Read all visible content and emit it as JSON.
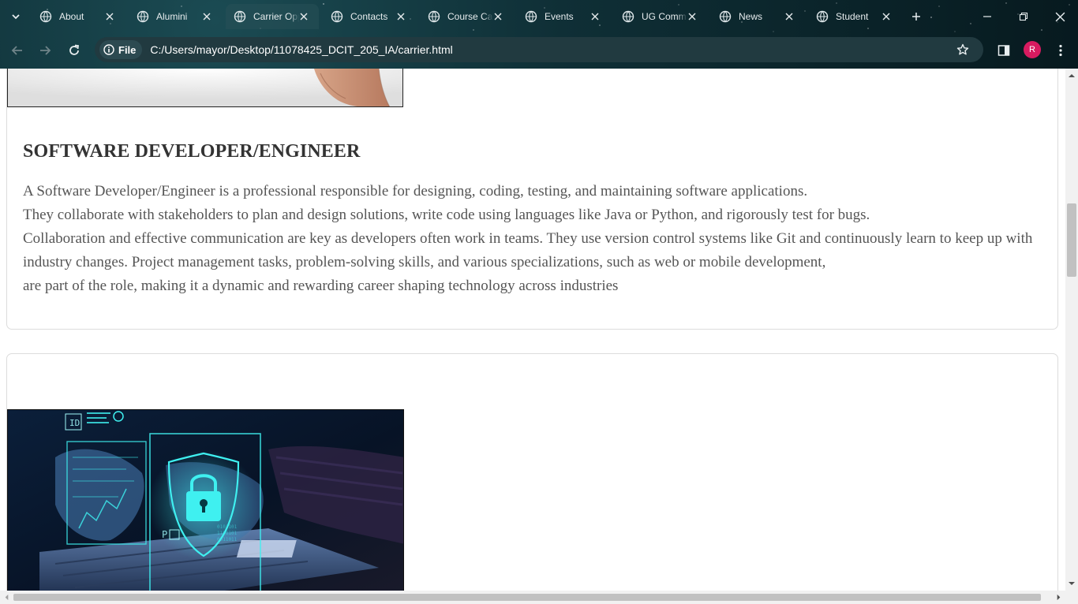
{
  "browser": {
    "tabs": [
      {
        "title": "About",
        "active": false
      },
      {
        "title": "Alumini",
        "active": false
      },
      {
        "title": "Carrier Opportunities",
        "active": true
      },
      {
        "title": "Contacts",
        "active": false
      },
      {
        "title": "Course Catalog",
        "active": false
      },
      {
        "title": "Events",
        "active": false
      },
      {
        "title": "UG Community",
        "active": false
      },
      {
        "title": "News",
        "active": false
      },
      {
        "title": "Student",
        "active": false
      }
    ],
    "site_chip_label": "File",
    "url": "C:/Users/mayor/Desktop/11078425_DCIT_205_IA/carrier.html",
    "profile_initial": "R",
    "profile_color": "#d81b60"
  },
  "page": {
    "section": {
      "title": "SOFTWARE DEVELOPER/ENGINEER",
      "paragraph_lines": [
        "A Software Developer/Engineer is a professional responsible for designing, coding, testing, and maintaining software applications.",
        "They collaborate with stakeholders to plan and design solutions, write code using languages like Java or Python, and rigorously test for bugs.",
        "Collaboration and effective communication are key as developers often work in teams. They use version control systems like Git and continuously learn to keep up with industry changes. Project management tasks, problem-solving skills, and various specializations, such as web or mobile development,",
        "are part of the role, making it a dynamic and rewarding career shaping technology across industries"
      ]
    }
  }
}
